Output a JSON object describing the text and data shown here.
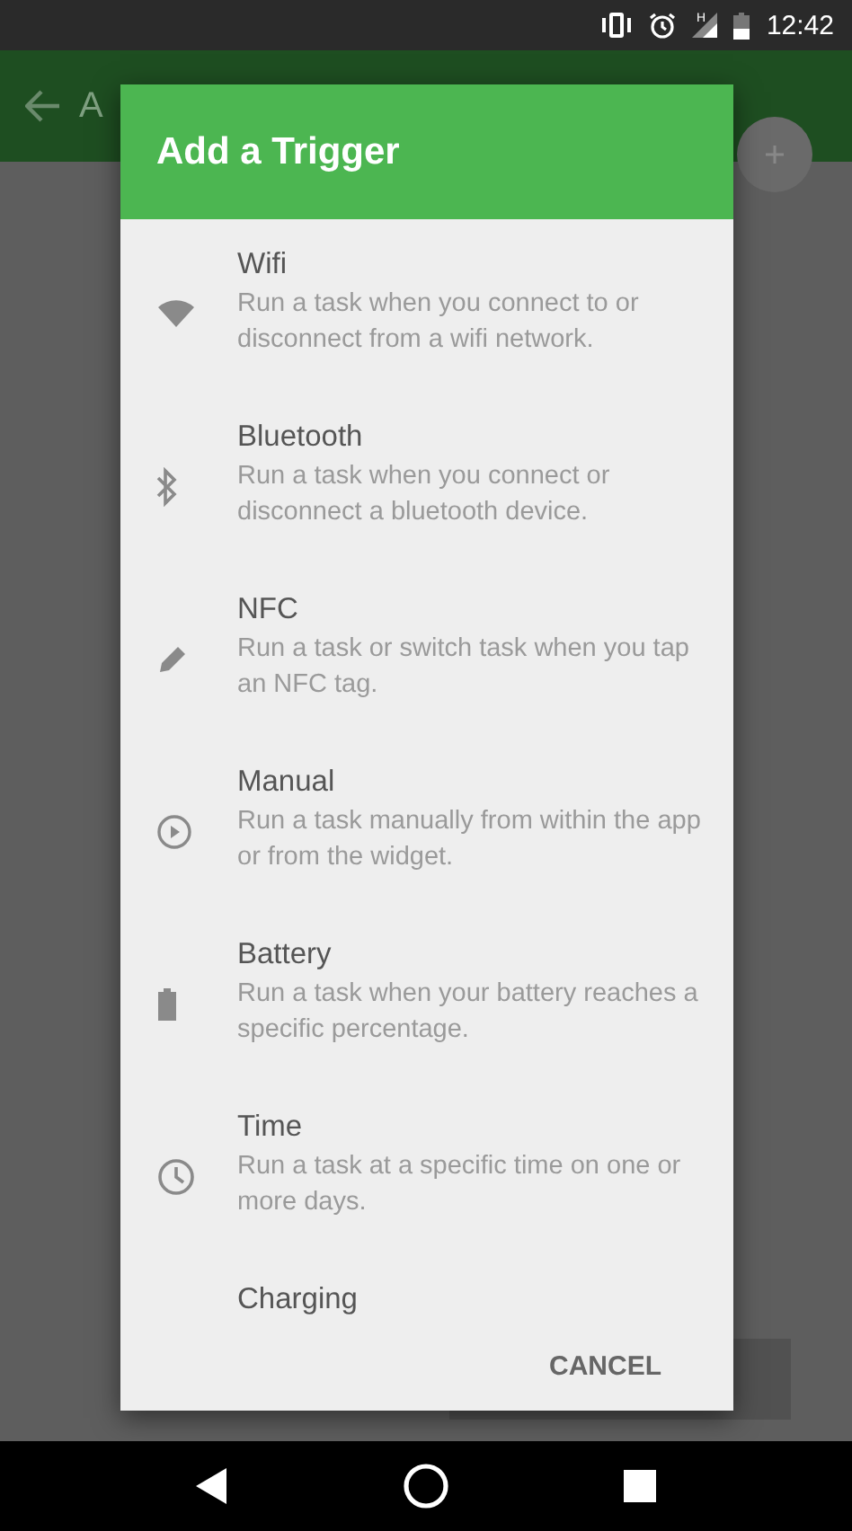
{
  "status_bar": {
    "network_label": "H",
    "time": "12:42"
  },
  "app_bar": {
    "title": "A"
  },
  "dialog": {
    "title": "Add a Trigger",
    "items": [
      {
        "kind": "wifi",
        "title": "Wifi",
        "description": "Run a task when you connect to or disconnect from a wifi network."
      },
      {
        "kind": "bluetooth",
        "title": "Bluetooth",
        "description": "Run a task when you connect or disconnect a bluetooth device."
      },
      {
        "kind": "nfc",
        "title": "NFC",
        "description": "Run a task or switch task when you tap an NFC tag."
      },
      {
        "kind": "manual",
        "title": "Manual",
        "description": "Run a task manually from within the app or from the widget."
      },
      {
        "kind": "battery",
        "title": "Battery",
        "description": "Run a task when your battery reaches a specific percentage."
      },
      {
        "kind": "time",
        "title": "Time",
        "description": "Run a task at a specific time on one or more days."
      },
      {
        "kind": "charging",
        "title": "Charging"
      }
    ],
    "buttons": [
      "CANCEL"
    ]
  }
}
